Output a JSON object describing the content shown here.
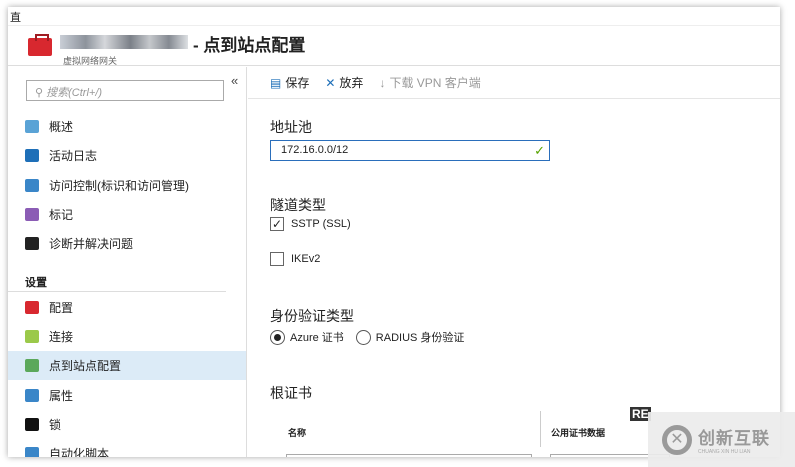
{
  "window": {
    "top_glyph": "直",
    "title": "- 点到站点配置",
    "subtitle": "虚拟网络网关"
  },
  "sidebar": {
    "search_placeholder": "搜索(Ctrl+/)",
    "collapse": "«",
    "items": [
      {
        "label": "概述",
        "color": "#5aa3d6"
      },
      {
        "label": "活动日志",
        "color": "#1e6fb8"
      },
      {
        "label": "访问控制(标识和访问管理)",
        "color": "#3a86c8"
      },
      {
        "label": "标记",
        "color": "#8b5cb5"
      },
      {
        "label": "诊断并解决问题",
        "color": "#222222"
      }
    ],
    "section": "设置",
    "settings": [
      {
        "label": "配置",
        "color": "#d8282f"
      },
      {
        "label": "连接",
        "color": "#9bc94a"
      },
      {
        "label": "点到站点配置",
        "color": "#5ba85b",
        "selected": true
      },
      {
        "label": "属性",
        "color": "#3a86c8"
      },
      {
        "label": "锁",
        "color": "#111111"
      },
      {
        "label": "自动化脚本",
        "color": "#3a86c8"
      }
    ]
  },
  "toolbar": {
    "save": "保存",
    "discard": "放弃",
    "download": "下载 VPN 客户端"
  },
  "content": {
    "address_pool_label": "地址池",
    "address_pool_value": "172.16.0.0/12",
    "tunnel_label": "隧道类型",
    "sstp": "SSTP (SSL)",
    "sstp_checked": true,
    "ikev2": "IKEv2",
    "ikev2_checked": false,
    "auth_label": "身份验证类型",
    "auth_azure": "Azure 证书",
    "auth_radius": "RADIUS 身份验证",
    "auth_selected": "Azure 证书",
    "root_cert_label": "根证书",
    "col_name": "名称",
    "col_data": "公用证书数据"
  },
  "watermark": {
    "overlay": "RE",
    "brand": "创新互联",
    "brand_pinyin": "CHUANG XIN HU LIAN"
  }
}
